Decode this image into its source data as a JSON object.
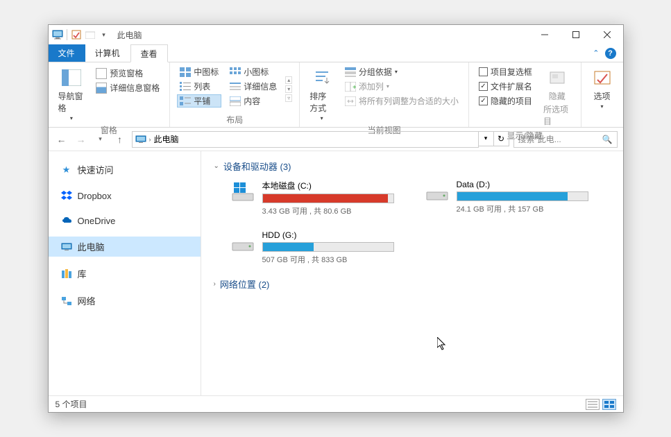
{
  "title": "此电脑",
  "tabs": {
    "file": "文件",
    "computer": "计算机",
    "view": "查看"
  },
  "ribbon": {
    "panes": {
      "navpane": "导航窗格",
      "preview": "预览窗格",
      "detailspane": "详细信息窗格",
      "group_label": "窗格"
    },
    "layout": {
      "medium": "中图标",
      "small": "小图标",
      "list": "列表",
      "details": "详细信息",
      "tiles": "平铺",
      "content": "内容",
      "group_label": "布局"
    },
    "currentview": {
      "sortby": "排序方式",
      "groupby": "分组依据",
      "addcols": "添加列",
      "sizecols": "将所有列调整为合适的大小",
      "group_label": "当前视图"
    },
    "showhide": {
      "checkboxes": "项目复选框",
      "extensions": "文件扩展名",
      "hidden": "隐藏的项目",
      "hide": "隐藏",
      "hide_sel": "所选项目",
      "group_label": "显示/隐藏"
    },
    "options": "选项"
  },
  "address": {
    "location": "此电脑",
    "search_placeholder": "搜索\"此电..."
  },
  "sidebar": {
    "quick": "快速访问",
    "dropbox": "Dropbox",
    "onedrive": "OneDrive",
    "thispc": "此电脑",
    "libraries": "库",
    "network": "网络"
  },
  "groups": {
    "devices": {
      "label": "设备和驱动器",
      "count": 3
    },
    "network": {
      "label": "网络位置",
      "count": 2
    }
  },
  "drives": [
    {
      "name": "本地磁盘 (C:)",
      "stats": "3.43 GB 可用 , 共 80.6 GB",
      "fill": 96,
      "color": "red",
      "type": "os"
    },
    {
      "name": "Data (D:)",
      "stats": "24.1 GB 可用 , 共 157 GB",
      "fill": 85,
      "color": "blue",
      "type": "hdd"
    },
    {
      "name": "HDD (G:)",
      "stats": "507 GB 可用 , 共 833 GB",
      "fill": 39,
      "color": "blue",
      "type": "hdd"
    }
  ],
  "status": "5 个项目"
}
